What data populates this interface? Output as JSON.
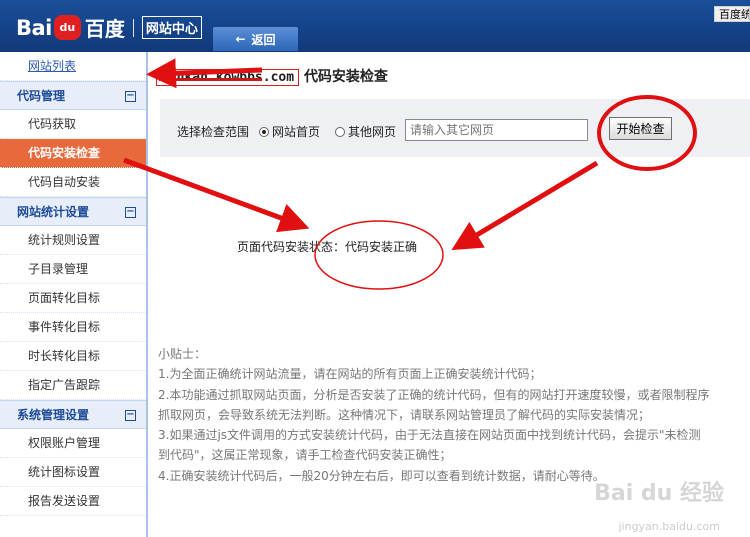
{
  "header": {
    "logo_en": "Bai",
    "logo_paw": "du",
    "logo_cn": "百度",
    "logo_sub": "网站中心",
    "back_label": "返回",
    "back_icon": "arrow-left-icon",
    "corner_tab": "百度统"
  },
  "sidebar": {
    "top_link": "网站列表",
    "groups": [
      {
        "title": "代码管理",
        "toggle": "⊟",
        "items": [
          "代码获取",
          "代码安装检查",
          "代码自动安装"
        ]
      },
      {
        "title": "网站统计设置",
        "toggle": "⊟",
        "items": [
          "统计规则设置",
          "子目录管理",
          "页面转化目标",
          "事件转化目标",
          "时长转化目标",
          "指定广告跟踪"
        ]
      },
      {
        "title": "系统管理设置",
        "toggle": "⊟",
        "items": [
          "权限账户管理",
          "统计图标设置",
          "报告发送设置"
        ]
      }
    ],
    "active_item": "代码安装检查"
  },
  "main": {
    "domain": "kankan.kowbbs.com",
    "title_suffix": "代码安装检查",
    "scope_label": "选择检查范围",
    "radio_home": "网站首页",
    "radio_other": "其他网页",
    "input_placeholder": "请输入其它网页",
    "start_button": "开始检查",
    "status_text": "页面代码安装状态：代码安装正确",
    "tips": [
      "小贴士：",
      "1.为全面正确统计网站流量，请在网站的所有页面上正确安装统计代码；",
      "2.本功能通过抓取网站页面，分析是否安装了正确的统计代码，但有的网站打开速度较慢，或者限制程序",
      "抓取网页，会导致系统无法判断。这种情况下，请联系网站管理员了解代码的实际安装情况；",
      "3.如果通过js文件调用的方式安装统计代码，由于无法直接在网站页面中找到统计代码，会提示\"未检测",
      "到代码\"，这属正常现象，请手工检查代码安装正确性；",
      "4.正确安装统计代码后，一般20分钟左右后，即可以查看到统计数据，请耐心等待。"
    ]
  },
  "watermark": {
    "main": "Bai du 经验",
    "sub": "jingyan.baidu.com"
  },
  "annotation_color": "#e01010"
}
